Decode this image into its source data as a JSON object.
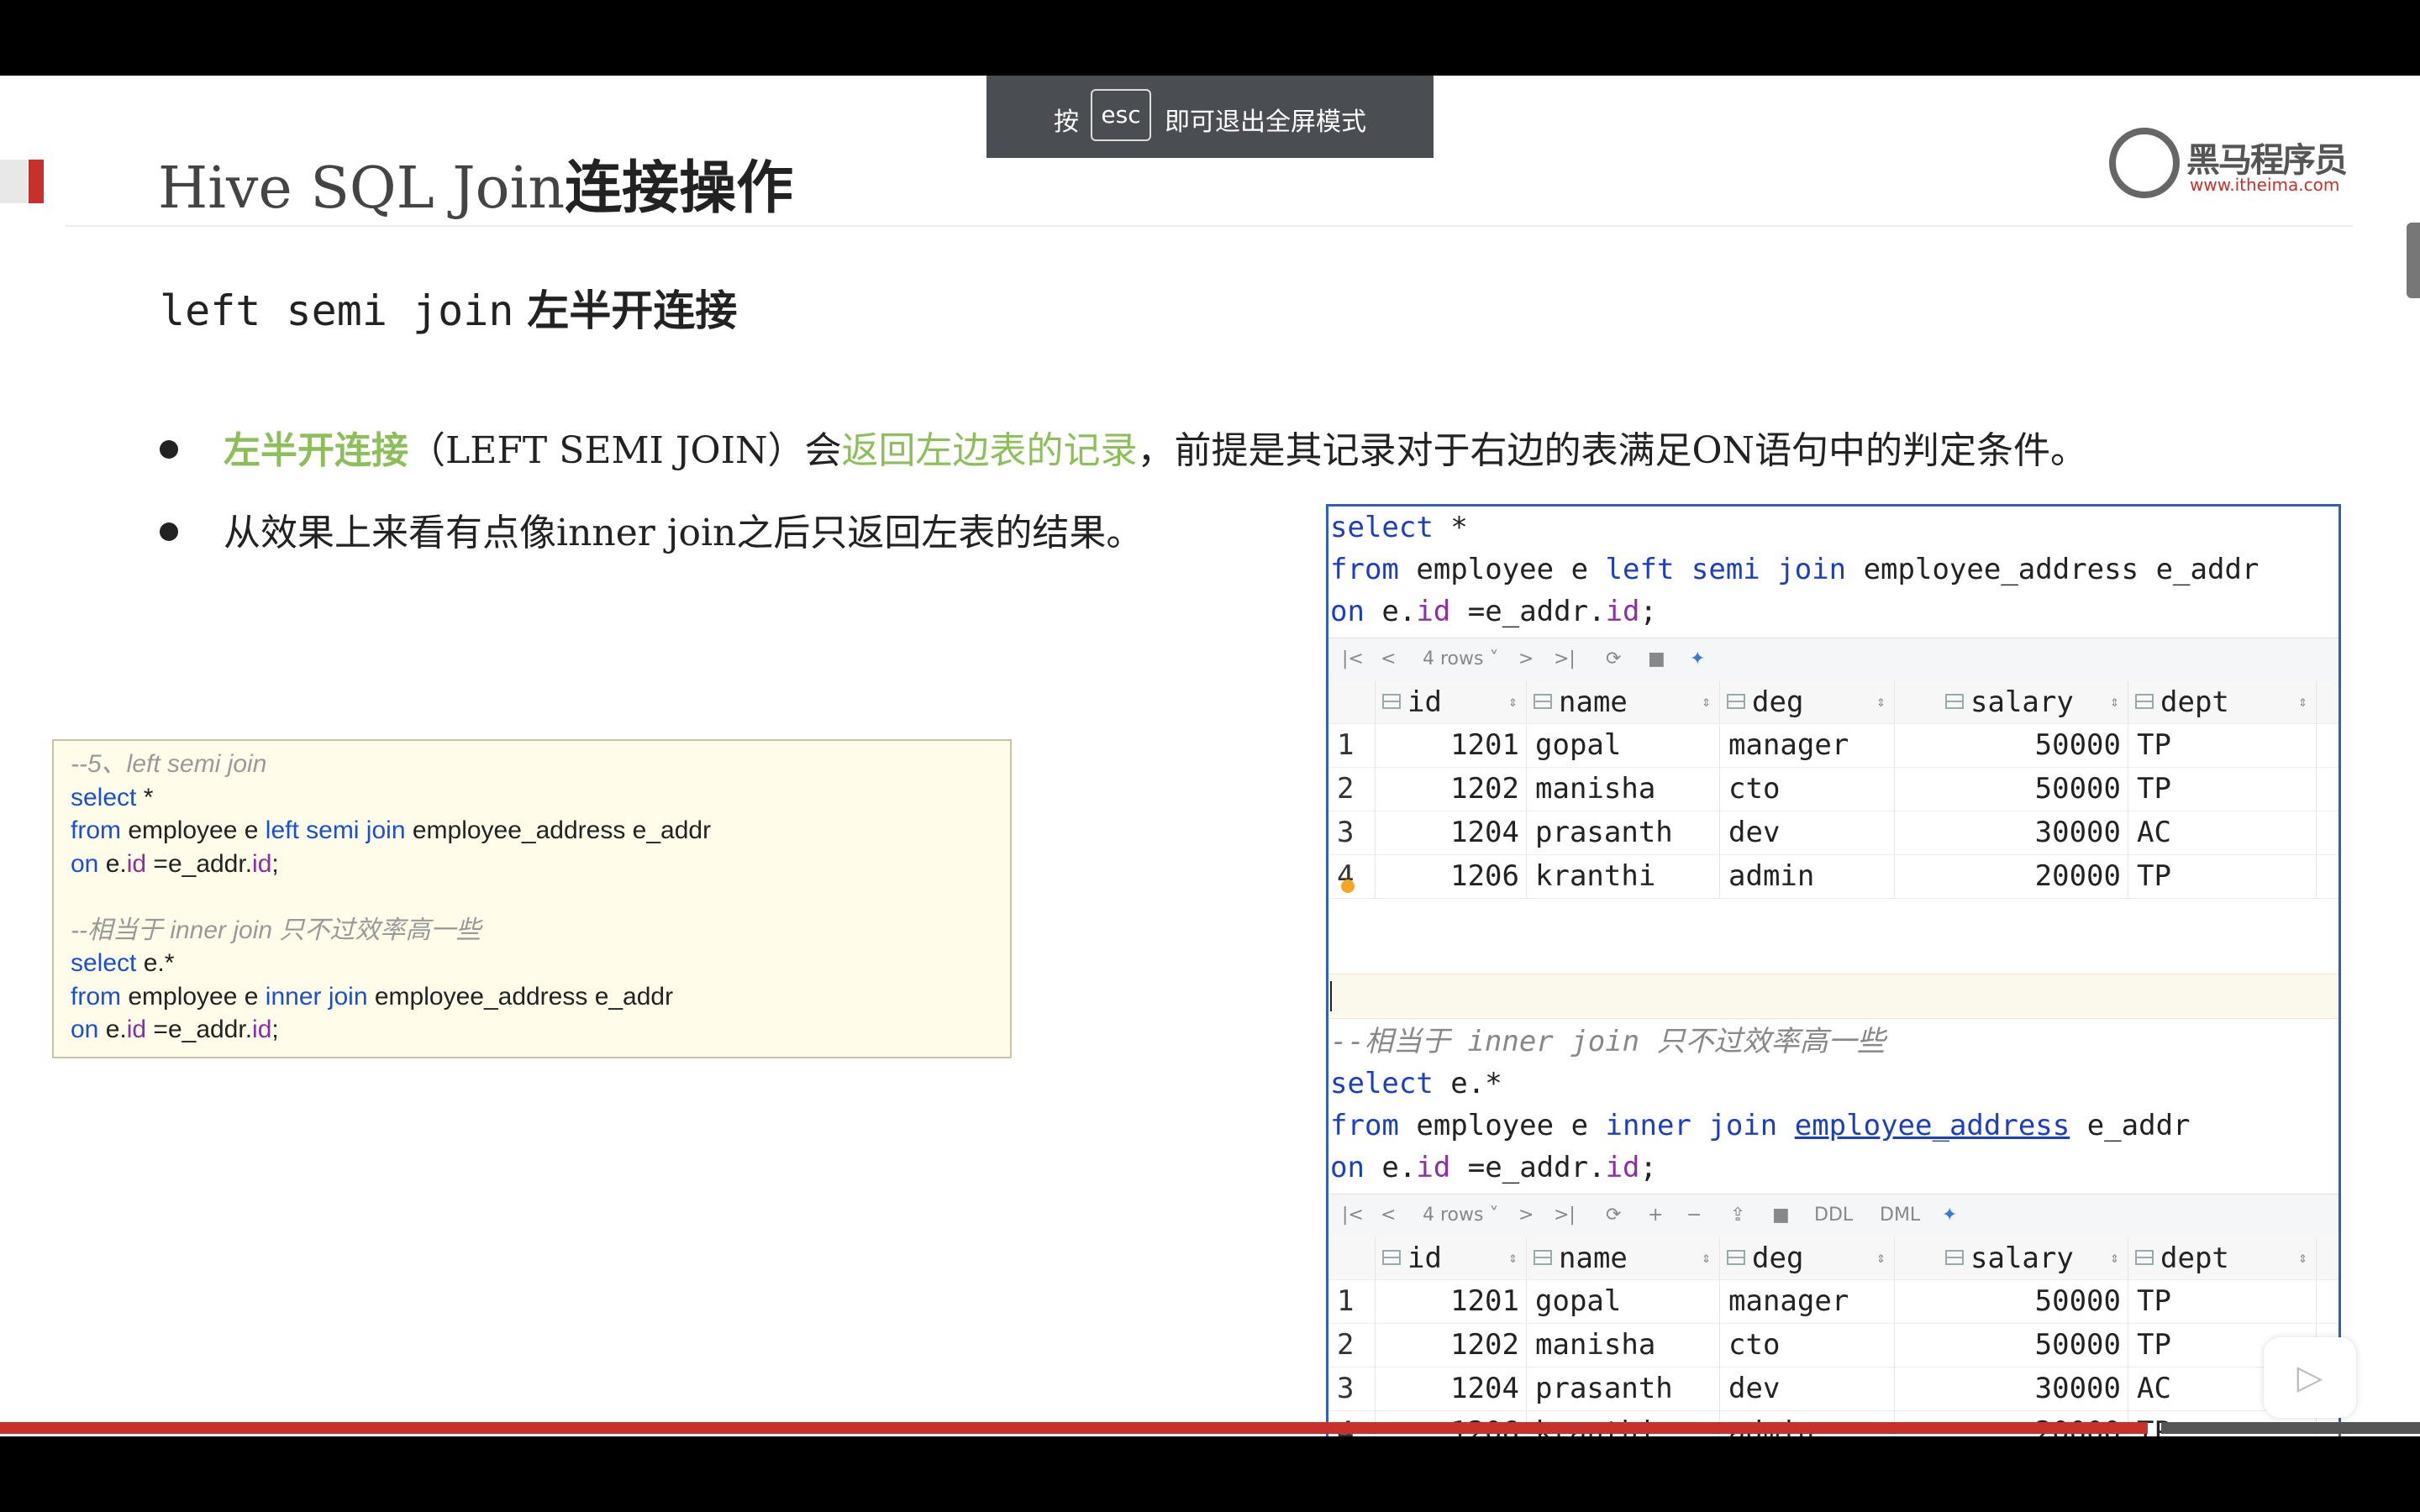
{
  "toast": {
    "press": "按",
    "key": "esc",
    "suffix": "即可退出全屏模式"
  },
  "slide": {
    "title_latin": "Hive SQL Join",
    "title_cn": "连接操作",
    "logo_name": "黑马程序员",
    "logo_url": "www.itheima.com",
    "subtitle_mono": "left semi join",
    "subtitle_cn": "左半开连接",
    "bullet1": {
      "green_bold": "左半开连接",
      "paren_open": "（",
      "en": "LEFT SEMI JOIN",
      "paren_close": "）会",
      "green": "返回左边表的记录",
      "rest": "，前提是其记录对于右边的表满足",
      "on": "ON",
      "tail": "语句中的判定条件。"
    },
    "bullet2": {
      "pre": "从效果上来看有点像",
      "inner": "inner join",
      "post": "之后只返回左表的结果。"
    },
    "code_box": {
      "l1": "--5、left semi join",
      "l2_kw": "select",
      "l2_rest": " *",
      "l3_from": "from",
      "l3_a": " employee e ",
      "l3_kw": "left semi join",
      "l3_b": " employee_address e_addr",
      "l4_on": "on",
      "l4_a": " e.",
      "l4_id": "id",
      "l4_b": " =e_addr.",
      "l4_id2": "id",
      "l4_c": ";",
      "l6": "--相当于 inner join 只不过效率高一些",
      "l7_kw": "select",
      "l7_rest": " e.*",
      "l8_from": "from",
      "l8_a": " employee e ",
      "l8_kw": "inner join",
      "l8_b": " employee_address e_addr",
      "l9_on": "on",
      "l9_a": " e.",
      "l9_id": "id",
      "l9_b": " =e_addr.",
      "l9_id2": "id",
      "l9_c": ";"
    }
  },
  "ide": {
    "q1": {
      "select": "select",
      "star": " *",
      "from": "from",
      "emp": " employee e ",
      "join": "left semi join",
      "addr": " employee_address e_addr",
      "on": "on",
      "e": " e.",
      "id": "id",
      "eq": " =e_addr.",
      "id2": "id",
      "semi": ";"
    },
    "q2": {
      "comment": "--相当于 inner join 只不过效率高一些",
      "select": "select",
      "cols": " e.*",
      "from": "from",
      "emp": " employee e ",
      "join": "inner join",
      "sp": " ",
      "addr": "employee_address",
      "alias": " e_addr",
      "on": "on",
      "e": " e.",
      "id": "id",
      "eq": " =e_addr.",
      "id2": "id",
      "semi": ";"
    },
    "toolbar": {
      "rows": "4 rows",
      "ddl": "DDL",
      "dml": "DML"
    },
    "columns": [
      "id",
      "name",
      "deg",
      "salary",
      "dept"
    ],
    "rows": [
      [
        "1",
        "1201",
        "gopal",
        "manager",
        "50000",
        "TP"
      ],
      [
        "2",
        "1202",
        "manisha",
        "cto",
        "50000",
        "TP"
      ],
      [
        "3",
        "1204",
        "prasanth",
        "dev",
        "30000",
        "AC"
      ],
      [
        "4",
        "1206",
        "kranthi",
        "admin",
        "20000",
        "TP"
      ]
    ]
  }
}
